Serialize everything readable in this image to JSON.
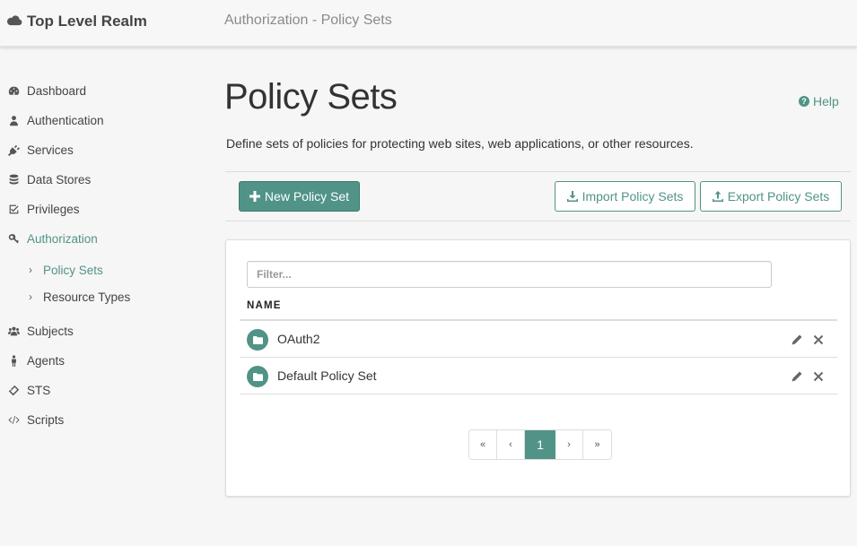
{
  "header": {
    "realm": "Top Level Realm",
    "realm_icon": "cloud-icon",
    "breadcrumb": "Authorization - Policy Sets"
  },
  "sidebar": {
    "items": [
      {
        "label": "Dashboard",
        "icon": "dashboard-icon"
      },
      {
        "label": "Authentication",
        "icon": "user-icon"
      },
      {
        "label": "Services",
        "icon": "plug-icon"
      },
      {
        "label": "Data Stores",
        "icon": "database-icon"
      },
      {
        "label": "Privileges",
        "icon": "check-square-icon"
      },
      {
        "label": "Authorization",
        "icon": "key-icon",
        "active": true
      },
      {
        "label": "Subjects",
        "icon": "users-icon"
      },
      {
        "label": "Agents",
        "icon": "male-icon"
      },
      {
        "label": "STS",
        "icon": "ticket-icon"
      },
      {
        "label": "Scripts",
        "icon": "code-icon"
      }
    ],
    "subitems": [
      {
        "label": "Policy Sets",
        "active": true
      },
      {
        "label": "Resource Types"
      }
    ],
    "chevron": "›"
  },
  "main": {
    "title": "Policy Sets",
    "help_label": "Help",
    "description": "Define sets of policies for protecting web sites, web applications, or other resources.",
    "toolbar": {
      "new_label": "New Policy Set",
      "import_label": "Import Policy Sets",
      "export_label": "Export Policy Sets"
    },
    "filter": {
      "placeholder": "Filter...",
      "value": ""
    },
    "table": {
      "columns": [
        "NAME"
      ],
      "rows": [
        {
          "name": "OAuth2"
        },
        {
          "name": "Default Policy Set"
        }
      ]
    },
    "pagination": {
      "first": "«",
      "prev": "‹",
      "current": "1",
      "next": "›",
      "last": "»"
    }
  },
  "colors": {
    "accent": "#519387",
    "background": "#f6f6f6",
    "text": "#333333"
  }
}
